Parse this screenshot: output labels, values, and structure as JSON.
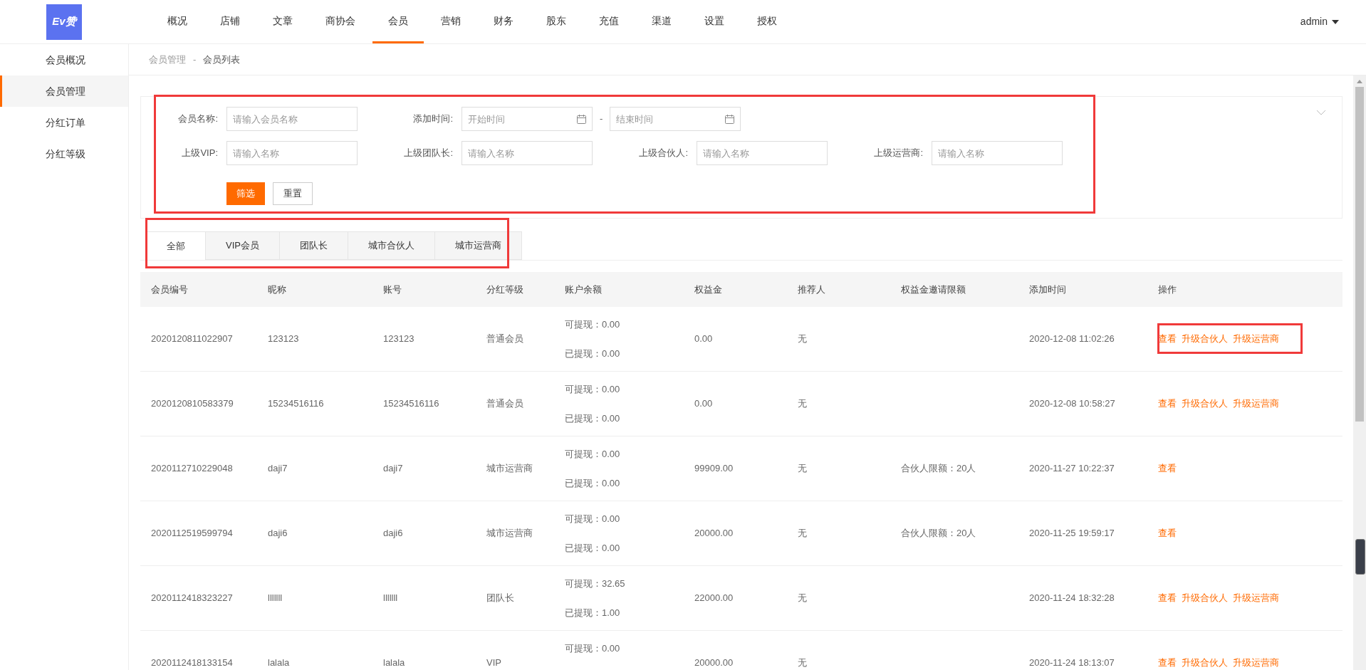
{
  "logo": {
    "text": "Ev赞"
  },
  "nav": [
    {
      "label": "概况",
      "selected": false
    },
    {
      "label": "店铺",
      "selected": false
    },
    {
      "label": "文章",
      "selected": false
    },
    {
      "label": "商协会",
      "selected": false
    },
    {
      "label": "会员",
      "selected": true
    },
    {
      "label": "营销",
      "selected": false
    },
    {
      "label": "财务",
      "selected": false
    },
    {
      "label": "股东",
      "selected": false
    },
    {
      "label": "充值",
      "selected": false
    },
    {
      "label": "渠道",
      "selected": false
    },
    {
      "label": "设置",
      "selected": false
    },
    {
      "label": "授权",
      "selected": false
    }
  ],
  "user": {
    "name": "admin"
  },
  "sidebar": {
    "items": [
      {
        "label": "会员概况",
        "selected": false
      },
      {
        "label": "会员管理",
        "selected": true
      },
      {
        "label": "分红订单",
        "selected": false
      },
      {
        "label": "分红等级",
        "selected": false
      }
    ]
  },
  "breadcrumb": [
    "会员管理",
    "-",
    "会员列表"
  ],
  "filter": {
    "row1": [
      {
        "label": "会员名称:",
        "placeholder": "请输入会员名称"
      }
    ],
    "date": {
      "label": "添加时间:",
      "start_placeholder": "开始时间",
      "separator": "-",
      "end_placeholder": "结束时间"
    },
    "row2": [
      {
        "label": "上级VIP:",
        "placeholder": "请输入名称"
      },
      {
        "label": "上级团队长:",
        "placeholder": "请输入名称"
      },
      {
        "label": "上级合伙人:",
        "placeholder": "请输入名称"
      },
      {
        "label": "上级运营商:",
        "placeholder": "请输入名称"
      }
    ],
    "buttons": [
      {
        "label": "筛选",
        "kind": "primary"
      },
      {
        "label": "重置",
        "kind": "default"
      }
    ]
  },
  "tabs": [
    {
      "label": "全部",
      "selected": true
    },
    {
      "label": "VIP会员",
      "selected": false
    },
    {
      "label": "团队长",
      "selected": false
    },
    {
      "label": "城市合伙人",
      "selected": false
    },
    {
      "label": "城市运营商",
      "selected": false
    }
  ],
  "table": {
    "columns": [
      "会员编号",
      "昵称",
      "账号",
      "分红等级",
      "账户余额",
      "权益金",
      "推荐人",
      "权益金邀请限额",
      "添加时间",
      "操作"
    ],
    "rows": [
      {
        "id": "2020120811022907",
        "nickname": "123123",
        "account": "123123",
        "level": "普通会员",
        "withdrawable": "可提现：0.00",
        "withdrawn": "已提现：0.00",
        "equity": "0.00",
        "referrer": "无",
        "limit": "",
        "time": "2020-12-08 11:02:26",
        "actions": [
          "查看",
          "升级合伙人",
          "升级运营商"
        ]
      },
      {
        "id": "2020120810583379",
        "nickname": "15234516116",
        "account": "15234516116",
        "level": "普通会员",
        "withdrawable": "可提现：0.00",
        "withdrawn": "已提现：0.00",
        "equity": "0.00",
        "referrer": "无",
        "limit": "",
        "time": "2020-12-08 10:58:27",
        "actions": [
          "查看",
          "升级合伙人",
          "升级运营商"
        ]
      },
      {
        "id": "2020112710229048",
        "nickname": "daji7",
        "account": "daji7",
        "level": "城市运营商",
        "withdrawable": "可提现：0.00",
        "withdrawn": "已提现：0.00",
        "equity": "99909.00",
        "referrer": "无",
        "limit": "合伙人限额：20人",
        "time": "2020-11-27 10:22:37",
        "actions": [
          "查看"
        ]
      },
      {
        "id": "2020112519599794",
        "nickname": "daji6",
        "account": "daji6",
        "level": "城市运营商",
        "withdrawable": "可提现：0.00",
        "withdrawn": "已提现：0.00",
        "equity": "20000.00",
        "referrer": "无",
        "limit": "合伙人限额：20人",
        "time": "2020-11-25 19:59:17",
        "actions": [
          "查看"
        ]
      },
      {
        "id": "2020112418323227",
        "nickname": "lllllll",
        "account": "lllllll",
        "level": "团队长",
        "withdrawable": "可提现：32.65",
        "withdrawn": "已提现：1.00",
        "equity": "22000.00",
        "referrer": "无",
        "limit": "",
        "time": "2020-11-24 18:32:28",
        "actions": [
          "查看",
          "升级合伙人",
          "升级运营商"
        ]
      },
      {
        "id": "2020112418133154",
        "nickname": "lalala",
        "account": "lalala",
        "level": "VIP",
        "withdrawable": "可提现：0.00",
        "equity": "20000.00",
        "referrer": "无",
        "limit": "",
        "time": "2020-11-24 18:13:07",
        "actions": [
          "查看",
          "升级合伙人",
          "升级运营商"
        ]
      }
    ]
  }
}
